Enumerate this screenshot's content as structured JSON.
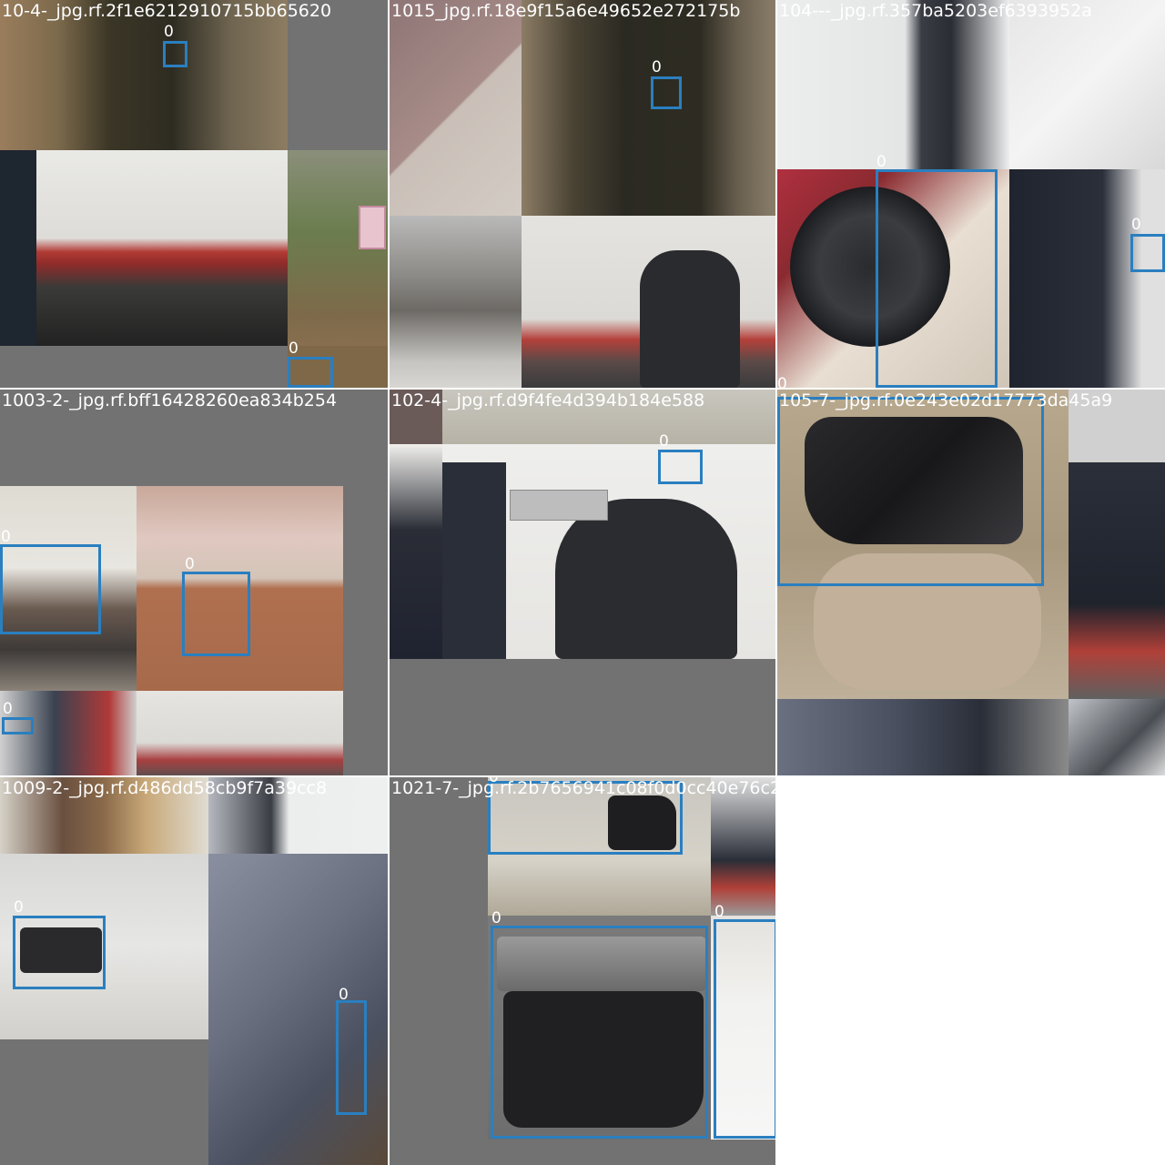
{
  "mosaic": {
    "tiles": [
      {
        "filename": "10-4-_jpg.rf.2f1e6212910715bb65620"
      },
      {
        "filename": "1015_jpg.rf.18e9f15a6e49652e272175b"
      },
      {
        "filename": "104---_jpg.rf.357ba5203ef6393952a"
      },
      {
        "filename": "1003-2-_jpg.rf.bff16428260ea834b254"
      },
      {
        "filename": "102-4-_jpg.rf.d9f4fe4d394b184e588"
      },
      {
        "filename": "105-7-_jpg.rf.0e243e02d17773da45a9"
      },
      {
        "filename": "1009-2-_jpg.rf.d486dd58cb9f7a39cc8"
      },
      {
        "filename": "1021-7-_jpg.rf.2b7656941c08f0d0cc40e76c2"
      }
    ],
    "class_label": "0",
    "colors": {
      "box": "#2a7fc0",
      "padding": "#727272",
      "label_text": "#ffffff"
    }
  }
}
